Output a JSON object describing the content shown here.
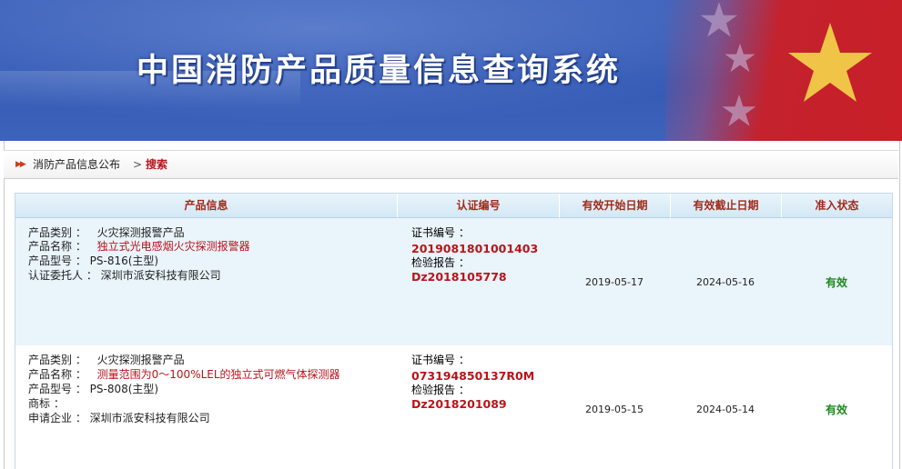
{
  "banner": {
    "title": "中国消防产品质量信息查询系统"
  },
  "breadcrumb": {
    "arrow_glyph": "▶▶",
    "home": "消防产品信息公布",
    "separator": ">",
    "current": "搜索"
  },
  "table": {
    "headers": {
      "product_info": "产品信息",
      "cert_no": "认证编号",
      "start_date": "有效开始日期",
      "end_date": "有效截止日期",
      "status": "准入状态"
    },
    "rows": [
      {
        "category_label": "产品类别 ：",
        "category": "火灾探测报警产品",
        "name_label": "产品名称 ：",
        "name": "独立式光电感烟火灾探测报警器",
        "model_label": "产品型号 ：",
        "model": "PS-816(主型)",
        "extra_label": "认证委托人 ：",
        "extra": "深圳市派安科技有限公司",
        "cert_label": "证书编号 ：",
        "cert_no": "2019081801001403",
        "report_label": "检验报告 ：",
        "report_no": "Dz2018105778",
        "start_date": "2019-05-17",
        "end_date": "2024-05-16",
        "status": "有效"
      },
      {
        "category_label": "产品类别 ：",
        "category": "火灾探测报警产品",
        "name_label": "产品名称 ：",
        "name": "测量范围为0～100%LEL的独立式可燃气体探测器",
        "model_label": "产品型号 ：",
        "model": "PS-808(主型)",
        "trademark_label": "商标 ：",
        "extra_label": "申请企业 ：",
        "extra": "深圳市派安科技有限公司",
        "cert_label": "证书编号 ：",
        "cert_no": "073194850137R0M",
        "report_label": "检验报告 ：",
        "report_no": "Dz2018201089",
        "start_date": "2019-05-15",
        "end_date": "2024-05-14",
        "status": "有效"
      }
    ]
  },
  "colors": {
    "banner_blue": "#3359b4",
    "flag_red": "#c81f28",
    "accent_red": "#b8141b",
    "status_green": "#1d8a1d",
    "header_text": "#a02b1a",
    "row_tint": "#eaf4fb"
  },
  "icons": {
    "breadcrumb_arrow": "double-right-arrow-icon",
    "flag_star": "star-icon"
  }
}
